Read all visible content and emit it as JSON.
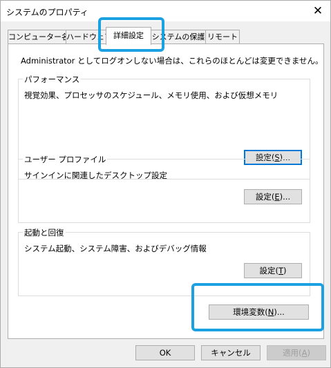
{
  "window": {
    "title": "システムのプロパティ",
    "close_glyph": "✕"
  },
  "tabs": [
    {
      "label": "コンピューター名",
      "active": false
    },
    {
      "label": "ハードウェア",
      "active": false
    },
    {
      "label": "詳細設定",
      "active": true
    },
    {
      "label": "システムの保護",
      "active": false
    },
    {
      "label": "リモート",
      "active": false
    }
  ],
  "panel": {
    "admin_note": "Administrator としてログオンしない場合は、これらのほとんどは変更できません。",
    "performance": {
      "legend": "パフォーマンス",
      "description": "視覚効果、プロセッサのスケジュール、メモリ使用、および仮想メモリ",
      "button": {
        "text": "設定(",
        "key": "S",
        "suffix": ")..."
      }
    },
    "user_profiles": {
      "legend": "ユーザー プロファイル",
      "description": "サインインに関連したデスクトップ設定",
      "button": {
        "text": "設定(",
        "key": "E",
        "suffix": ")..."
      }
    },
    "startup_recovery": {
      "legend": "起動と回復",
      "description": "システム起動、システム障害、およびデバッグ情報",
      "button": {
        "text": "設定(",
        "key": "T",
        "suffix": ")"
      }
    },
    "env_vars_button": {
      "text": "環境変数(",
      "key": "N",
      "suffix": ")..."
    }
  },
  "footer": {
    "ok": "OK",
    "cancel": "キャンセル",
    "apply": {
      "text": "適用(",
      "key": "A",
      "suffix": ")"
    }
  },
  "highlight_color": "#1ba1e2"
}
